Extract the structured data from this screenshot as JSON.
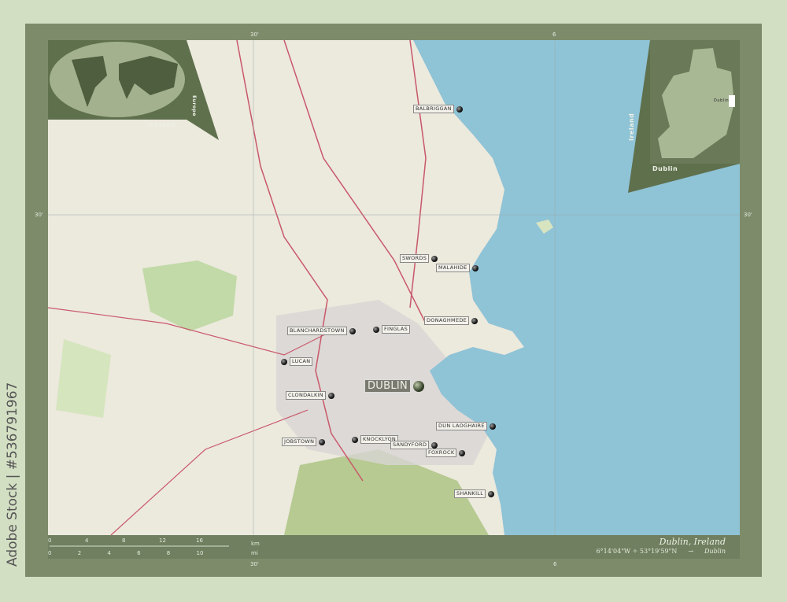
{
  "title": "Dublin, Ireland",
  "coordinates": "6°14'04\"W ✧ 53°19'59\"N",
  "arrow": "→",
  "region": "Dublin",
  "watermark": "Adobe Stock | #536791967",
  "inset_world": {
    "label": "Ireland",
    "side_label": "Europe"
  },
  "inset_country": {
    "label": "Dublin",
    "side_label": "Ireland",
    "marker_label": "Dublin"
  },
  "grid_ticks": {
    "top_30": "30'",
    "top_6": "6",
    "left_30": "30'",
    "right_30": "30'",
    "bottom_30": "30'",
    "bottom_6": "6"
  },
  "scale": {
    "km_ticks": [
      "0",
      "4",
      "8",
      "12",
      "16"
    ],
    "km_unit": "km",
    "mi_ticks": [
      "0",
      "2",
      "4",
      "6",
      "8",
      "10"
    ],
    "mi_unit": "mi"
  },
  "cities": [
    {
      "name": "Balbriggan"
    },
    {
      "name": "Swords"
    },
    {
      "name": "Malahide"
    },
    {
      "name": "Blanchardstown"
    },
    {
      "name": "Finglas"
    },
    {
      "name": "Donaghmede"
    },
    {
      "name": "Lucan"
    },
    {
      "name": "Clondalkin"
    },
    {
      "name": "Dun Laoghaire"
    },
    {
      "name": "Jobstown"
    },
    {
      "name": "Knocklyon"
    },
    {
      "name": "Sandyford"
    },
    {
      "name": "Foxrock"
    },
    {
      "name": "Shankill"
    }
  ],
  "capital": {
    "name": "Dublin"
  },
  "colors": {
    "sea": "#8fc3d6",
    "land": "#eeeae0",
    "frame": "#7d8b6b",
    "inset": "#6a7a58"
  }
}
